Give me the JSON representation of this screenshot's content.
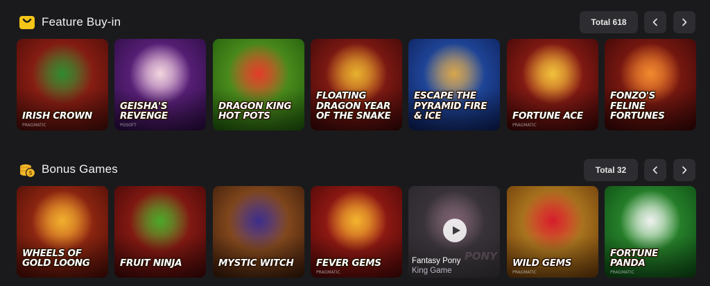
{
  "sections": {
    "feature": {
      "title": "Feature Buy-in",
      "icon": "shopping-bag-icon",
      "total": "Total 618",
      "games": [
        {
          "title": "IRISH CROWN",
          "provider": "PRAGMATIC",
          "bg1": "#b52a1b",
          "bg2": "#4a0c08",
          "accent": "#2f8a2f"
        },
        {
          "title": "GEISHA'S REVENGE",
          "provider": "PGSOFT",
          "bg1": "#7a2fa0",
          "bg2": "#2a0b40",
          "accent": "#f2d6dd"
        },
        {
          "title": "DRAGON KING HOT POTS",
          "provider": "",
          "bg1": "#6bb028",
          "bg2": "#1f5a0c",
          "accent": "#e23b28"
        },
        {
          "title": "FLOATING DRAGON YEAR OF THE SNAKE",
          "provider": "",
          "bg1": "#b1271c",
          "bg2": "#3a0707",
          "accent": "#e6b22e"
        },
        {
          "title": "ESCAPE THE PYRAMID FIRE & ICE",
          "provider": "",
          "bg1": "#2e63c8",
          "bg2": "#0c1f5a",
          "accent": "#d9a54a"
        },
        {
          "title": "FORTUNE ACE",
          "provider": "PRAGMATIC",
          "bg1": "#b7281c",
          "bg2": "#3d0707",
          "accent": "#f0c33a"
        },
        {
          "title": "FONZO'S FELINE FORTUNES",
          "provider": "",
          "bg1": "#a82618",
          "bg2": "#380606",
          "accent": "#f08a2e"
        }
      ]
    },
    "bonus": {
      "title": "Bonus Games",
      "icon": "coins-icon",
      "total": "Total 32",
      "games": [
        {
          "title": "WHEELS OF GOLD LOONG",
          "provider": "",
          "bg1": "#c13a1a",
          "bg2": "#4a0c06",
          "accent": "#f0b02e"
        },
        {
          "title": "FRUIT NINJA",
          "provider": "",
          "bg1": "#b3261b",
          "bg2": "#420707",
          "accent": "#4aa82a"
        },
        {
          "title": "MYSTIC WITCH",
          "provider": "",
          "bg1": "#b86a2a",
          "bg2": "#3a1a0a",
          "accent": "#3a2c8a"
        },
        {
          "title": "FEVER GEMS",
          "provider": "PRAGMATIC",
          "bg1": "#c2261c",
          "bg2": "#4a0707",
          "accent": "#f2b62e"
        },
        {
          "title": "",
          "provider": "",
          "bg1": "#6a5a62",
          "bg2": "#2a2228",
          "accent": "#e6a8c8",
          "overlay_name": "Fantasy Pony",
          "overlay_provider": "King Game",
          "faded_logo": "PONY"
        },
        {
          "title": "WILD GEMS",
          "provider": "PRAGMATIC",
          "bg1": "#d9a02e",
          "bg2": "#6a3a0a",
          "accent": "#d41c2a"
        },
        {
          "title": "FORTUNE PANDA",
          "provider": "PRAGMATIC",
          "bg1": "#3aa83a",
          "bg2": "#0c4a14",
          "accent": "#f0f0f0"
        }
      ]
    }
  },
  "nav": {
    "prev_icon": "chevron-left-icon",
    "next_icon": "chevron-right-icon",
    "play_icon": "play-icon"
  },
  "colors": {
    "background": "#1a1a1c",
    "badge": "#2d2d31",
    "bag_icon": "#f5c518",
    "coin_icon": "#f3b82a"
  }
}
